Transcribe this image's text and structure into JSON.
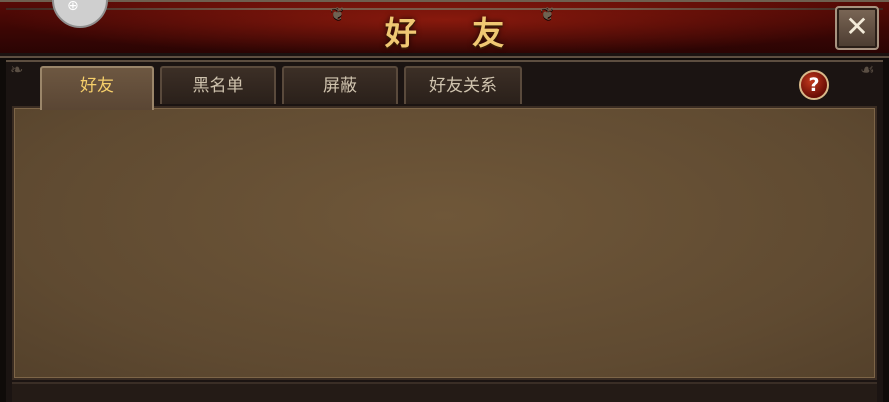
{
  "window": {
    "title": "好  友"
  },
  "tabs": [
    {
      "label": "好友",
      "active": true
    },
    {
      "label": "黑名单",
      "active": false
    },
    {
      "label": "屏蔽",
      "active": false
    },
    {
      "label": "好友关系",
      "active": false
    }
  ],
  "buttons": {
    "close_glyph": "✕",
    "help_glyph": "?"
  },
  "avatar": {
    "glyph": "⊕"
  },
  "colors": {
    "title_text": "#f0c873",
    "active_tab_text": "#f6cf6a",
    "inactive_tab_text": "#cfc3ae",
    "panel_bg": "#5f4a31",
    "title_bar_red": "#5a0b06"
  }
}
